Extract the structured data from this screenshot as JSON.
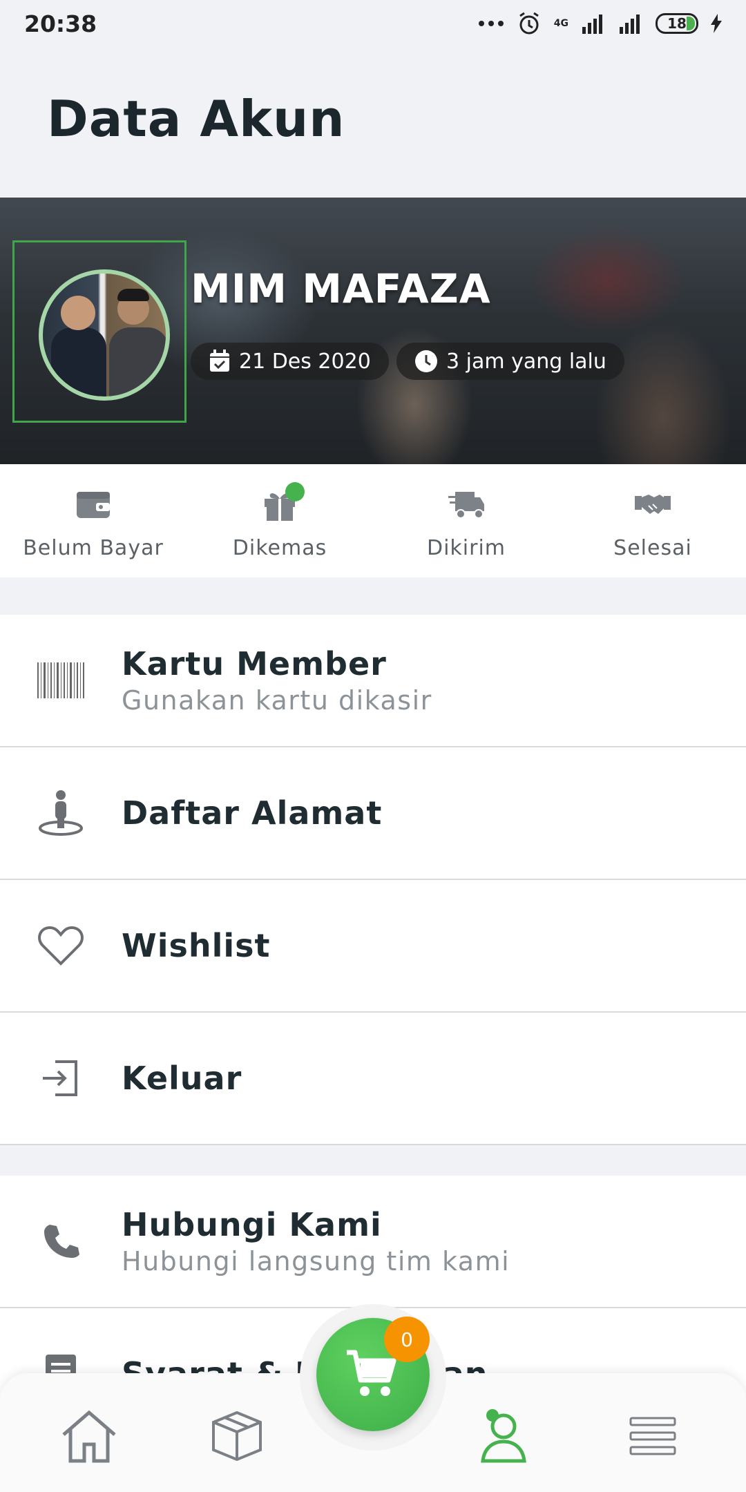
{
  "status_bar": {
    "time": "20:38",
    "network": "4G",
    "battery": "18"
  },
  "header": {
    "title": "Data Akun"
  },
  "profile": {
    "name": "MIM MAFAZA",
    "join_date": "21 Des 2020",
    "last_active": "3 jam yang lalu"
  },
  "orders": [
    {
      "label": "Belum Bayar",
      "icon": "wallet-icon"
    },
    {
      "label": "Dikemas",
      "icon": "gift-icon",
      "has_dot": true
    },
    {
      "label": "Dikirim",
      "icon": "truck-icon"
    },
    {
      "label": "Selesai",
      "icon": "handshake-icon"
    }
  ],
  "menu": [
    {
      "title": "Kartu Member",
      "subtitle": "Gunakan kartu dikasir",
      "icon": "barcode-icon"
    },
    {
      "title": "Daftar Alamat",
      "icon": "location-person-icon"
    },
    {
      "title": "Wishlist",
      "icon": "heart-icon"
    },
    {
      "title": "Keluar",
      "icon": "logout-icon"
    }
  ],
  "menu2": [
    {
      "title": "Hubungi Kami",
      "subtitle": "Hubungi langsung tim kami",
      "icon": "phone-icon"
    },
    {
      "title": "Syarat & Ketentuan",
      "icon": "document-icon"
    }
  ],
  "bottom_nav": {
    "cart_count": "0",
    "items": [
      "home-icon",
      "box-icon",
      "cart-icon",
      "profile-icon",
      "menu-icon"
    ],
    "active": "profile-icon",
    "colors": {
      "accent": "#46b24e",
      "badge": "#f59300"
    }
  }
}
